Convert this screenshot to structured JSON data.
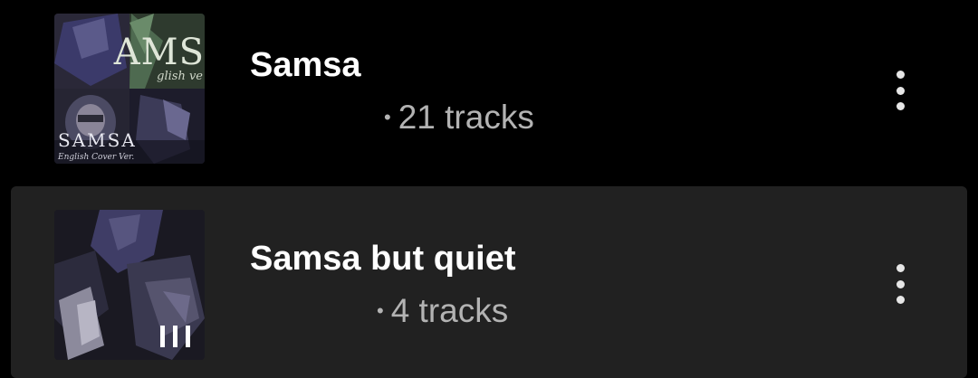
{
  "playlists": [
    {
      "title": "Samsa",
      "separator": "•",
      "track_count": "21 tracks",
      "cover_text": "SAMSA",
      "cover_subtext": "English Cover Ver.",
      "cover_top_text": "AMS",
      "cover_top_subtext": "glish ve",
      "now_playing": false
    },
    {
      "title": "Samsa but quiet",
      "separator": "•",
      "track_count": "4 tracks",
      "now_playing": true
    }
  ],
  "icons": {
    "more": "more-vert-icon",
    "playing": "equalizer-bars-icon"
  },
  "colors": {
    "background": "#000000",
    "selected_row": "#212121",
    "title": "#ffffff",
    "subtitle": "#b3b3b3"
  }
}
